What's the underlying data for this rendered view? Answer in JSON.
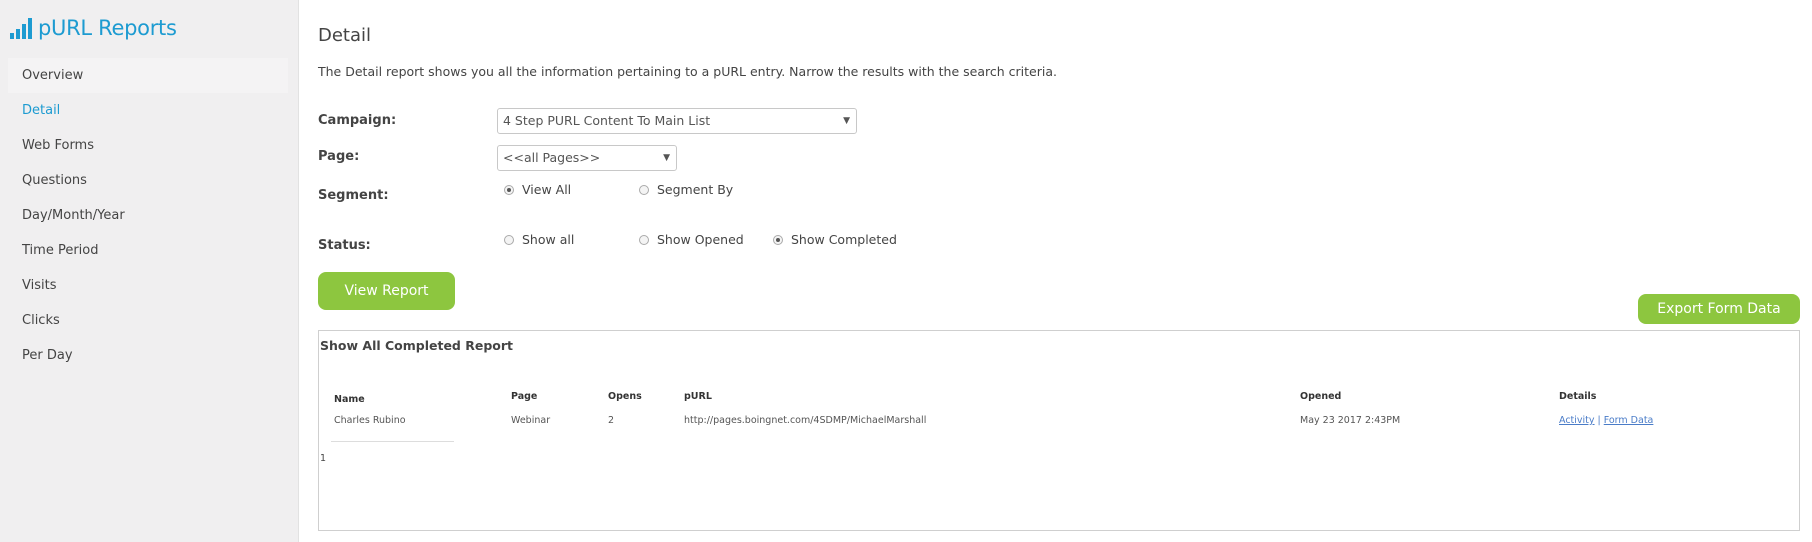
{
  "app": {
    "brand_title": "pURL Reports",
    "brand_icon": "bar-chart-icon",
    "accent_color": "#1d9bd1",
    "button_color": "#8dc63f"
  },
  "sidebar": {
    "items": [
      {
        "label": "Overview",
        "active": false
      },
      {
        "label": "Detail",
        "active": true
      },
      {
        "label": "Web Forms",
        "active": false
      },
      {
        "label": "Questions",
        "active": false
      },
      {
        "label": "Day/Month/Year",
        "active": false
      },
      {
        "label": "Time Period",
        "active": false
      },
      {
        "label": "Visits",
        "active": false
      },
      {
        "label": "Clicks",
        "active": false
      },
      {
        "label": "Per Day",
        "active": false
      }
    ]
  },
  "main": {
    "title": "Detail",
    "description": "The Detail report shows you all the information pertaining to a pURL entry. Narrow the results with the search criteria.",
    "form": {
      "campaign_label": "Campaign:",
      "campaign_value": "4 Step PURL Content To Main List",
      "page_label": "Page:",
      "page_value": "<<all Pages>>",
      "segment_label": "Segment:",
      "segment_options": [
        {
          "label": "View All",
          "checked": true
        },
        {
          "label": "Segment By",
          "checked": false
        }
      ],
      "status_label": "Status:",
      "status_options": [
        {
          "label": "Show all",
          "checked": false
        },
        {
          "label": "Show Opened",
          "checked": false
        },
        {
          "label": "Show Completed",
          "checked": true
        }
      ]
    },
    "view_report_label": "View Report",
    "export_label": "Export Form Data",
    "report": {
      "title": "Show All Completed Report",
      "columns": [
        "Name",
        "Page",
        "Opens",
        "pURL",
        "Opened",
        "Details"
      ],
      "rows": [
        {
          "name": "Charles Rubino",
          "page": "Webinar",
          "opens": "2",
          "purl": "http://pages.boingnet.com/4SDMP/MichaelMarshall",
          "opened": "May 23 2017 2:43PM",
          "details_links": [
            "Activity",
            "Form Data"
          ],
          "details_separator": "|"
        }
      ],
      "pager": "1"
    }
  }
}
